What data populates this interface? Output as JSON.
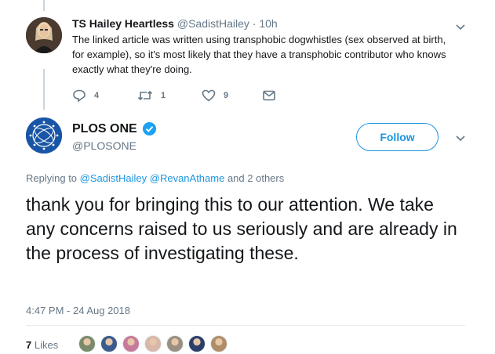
{
  "tweet1": {
    "name": "TS Hailey Heartless",
    "handle": "@SadistHailey",
    "time": "· 10h",
    "text": "The linked article was written using transphobic dogwhistles (sex observed at birth, for example), so it's most likely that they have a transphobic contributor who knows exactly what they're doing.",
    "actions": {
      "replies": "4",
      "retweets": "1",
      "likes": "9"
    },
    "icons": [
      "reply-icon",
      "retweet-icon",
      "heart-icon",
      "envelope-icon"
    ]
  },
  "tweet2": {
    "name": "PLOS ONE",
    "handle": "@PLOSONE",
    "follow_label": "Follow",
    "replying_prefix": "Replying to",
    "replying_mention1": "@SadistHailey",
    "replying_mention2": "@RevanAthame",
    "replying_suffix": "and 2 others",
    "text": "thank you for bringing this to our attention. We take any concerns raised to us seriously and are already in the process of investigating these.",
    "timestamp": "4:47 PM - 24 Aug 2018",
    "likes_count": "7",
    "likes_label": "Likes"
  },
  "colors": {
    "accent": "#1b95e0",
    "muted": "#657786",
    "text": "#14171a",
    "verified": "#1da1f2",
    "plos_blue": "#1955a6"
  },
  "likers": [
    {
      "color": "#7a8a6a"
    },
    {
      "color": "#3b5b8c"
    },
    {
      "color": "#c77b9a"
    },
    {
      "color": "#d8b8a8"
    },
    {
      "color": "#9a8f80"
    },
    {
      "color": "#2c3e6b"
    },
    {
      "color": "#b08d6a"
    }
  ]
}
